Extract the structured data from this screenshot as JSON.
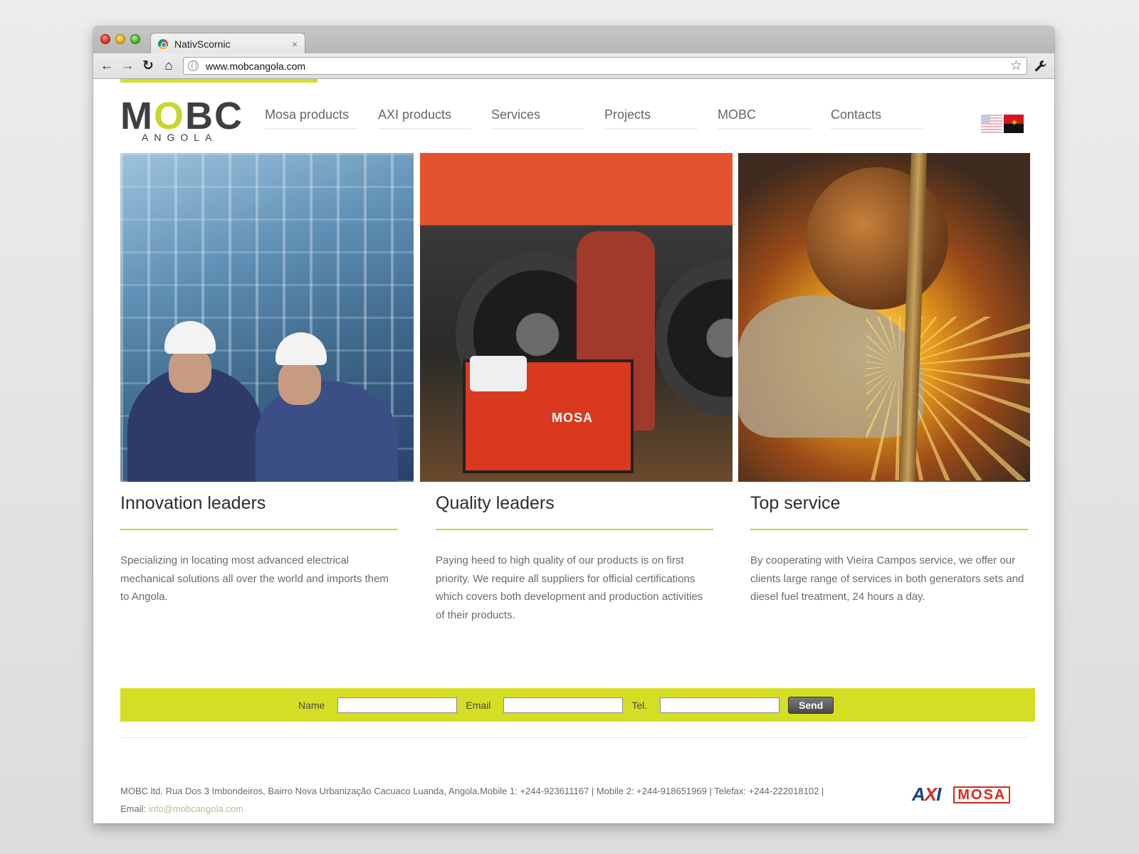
{
  "browser": {
    "tab_title": "NativScornic",
    "tab_close": "×",
    "url": "www.mobcangola.com",
    "back": "←",
    "forward": "→",
    "reload": "↻",
    "home": "⌂",
    "star": "☆",
    "wrench": "🔧"
  },
  "logo": {
    "main_prefix": "M",
    "main_o": "O",
    "main_suffix": "BC",
    "sub": "ANGOLA"
  },
  "nav": [
    {
      "label": "Mosa products"
    },
    {
      "label": "AXI products"
    },
    {
      "label": "Services"
    },
    {
      "label": "Projects"
    },
    {
      "label": "MOBC"
    },
    {
      "label": "Contacts"
    }
  ],
  "hero": {
    "generator_label": "MOSA"
  },
  "columns": [
    {
      "title": "Innovation leaders",
      "text": "Specializing in locating most advanced electrical mechanical solutions all over the world and imports them to Angola."
    },
    {
      "title": "Quality leaders",
      "text": "Paying heed to high quality of our products is on first priority. We require all suppliers for official certifications which covers both development and production activities of their products."
    },
    {
      "title": "Top service",
      "text": "By cooperating with Vieira Campos service, we offer our clients large range of services in both generators sets and diesel fuel treatment, 24 hours a day."
    }
  ],
  "form": {
    "name_label": "Name",
    "name_value": "",
    "email_label": "Email",
    "email_value": "",
    "tel_label": "Tel.",
    "tel_value": "",
    "send_label": "Send"
  },
  "footer": {
    "address": "MOBC ltd. Rua Dos 3 Imbondeiros, Bairro Nova Urbanização Cacuaco Luanda, Angola.Mobile 1: +244-923611167 | Mobile 2: +244-918651969 | Telefax: +244-222018102 |",
    "email_label": "Email:",
    "email": "info@mobcangola.com"
  },
  "partner_logos": {
    "axi_a": "A",
    "axi_x": "X",
    "axi_i": "I",
    "mosa": "MOSA"
  },
  "colors": {
    "accent": "#d5de24",
    "text": "#6a6a6a",
    "heading": "#2d2d2d"
  }
}
